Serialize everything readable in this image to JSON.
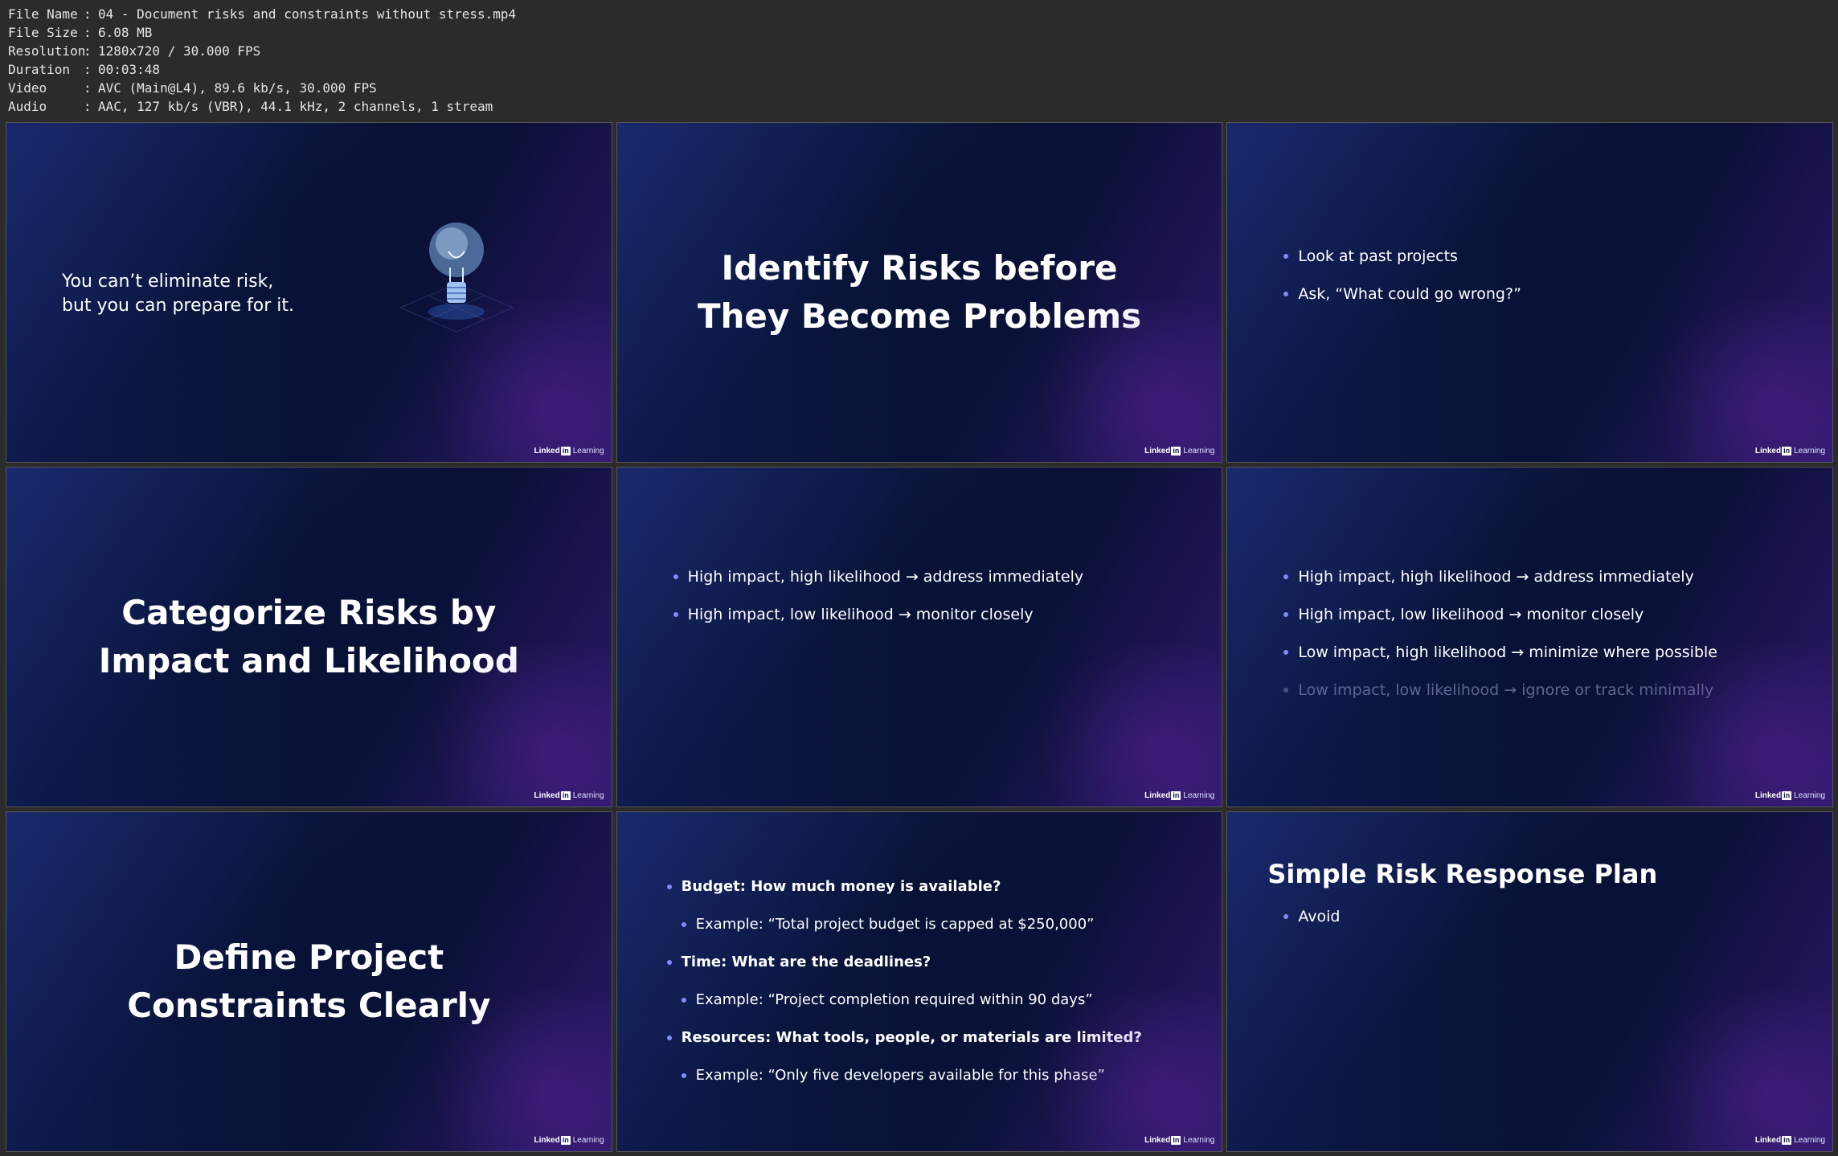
{
  "header": {
    "rows": [
      {
        "label": "File Name",
        "value": "04 - Document risks and constraints without stress.mp4"
      },
      {
        "label": "File Size",
        "value": "6.08 MB"
      },
      {
        "label": "Resolution",
        "value": "1280x720 / 30.000 FPS"
      },
      {
        "label": "Duration",
        "value": "00:03:48"
      },
      {
        "label": "Video",
        "value": "AVC (Main@L4), 89.6 kb/s, 30.000 FPS"
      },
      {
        "label": "Audio",
        "value": "AAC, 127 kb/s (VBR), 44.1 kHz, 2 channels, 1 stream"
      }
    ],
    "separator": ":"
  },
  "logo": {
    "part1": "Linked",
    "part2": "in",
    "part3": "Learning"
  },
  "slides": {
    "s1": {
      "line1": "You can’t eliminate risk,",
      "line2": "but you can prepare for it.",
      "icon": "lightbulb-icon"
    },
    "s2": {
      "line1": "Identify Risks before",
      "line2": "They Become Problems"
    },
    "s3": {
      "bullets": [
        "Look at past projects",
        "Ask, “What could go wrong?”"
      ]
    },
    "s4": {
      "line1": "Categorize Risks by",
      "line2": "Impact and Likelihood"
    },
    "s5": {
      "bullets": [
        "High impact, high likelihood → address immediately",
        "High impact, low likelihood → monitor closely"
      ]
    },
    "s6": {
      "bullets": [
        "High impact, high likelihood → address immediately",
        "High impact, low likelihood → monitor closely",
        "Low impact, high likelihood → minimize where possible",
        "Low impact, low likelihood → ignore or track minimally"
      ]
    },
    "s7": {
      "line1": "Define Project",
      "line2": "Constraints Clearly"
    },
    "s8": {
      "bullets": [
        "Budget: How much money is available?",
        "Example: “Total project budget is capped at $250,000”",
        "Time: What are the deadlines?",
        "Example: “Project completion required within 90 days”",
        "Resources: What tools, people, or materials are limited?",
        "Example: “Only five developers available for this phase”"
      ]
    },
    "s9": {
      "title": "Simple Risk Response Plan",
      "bullets": [
        "Avoid"
      ]
    }
  },
  "colors": {
    "background": "#2b2b2b",
    "slide_bg": "#081236",
    "bullet": "#7d8cff",
    "dim_text": "#5d6690"
  }
}
